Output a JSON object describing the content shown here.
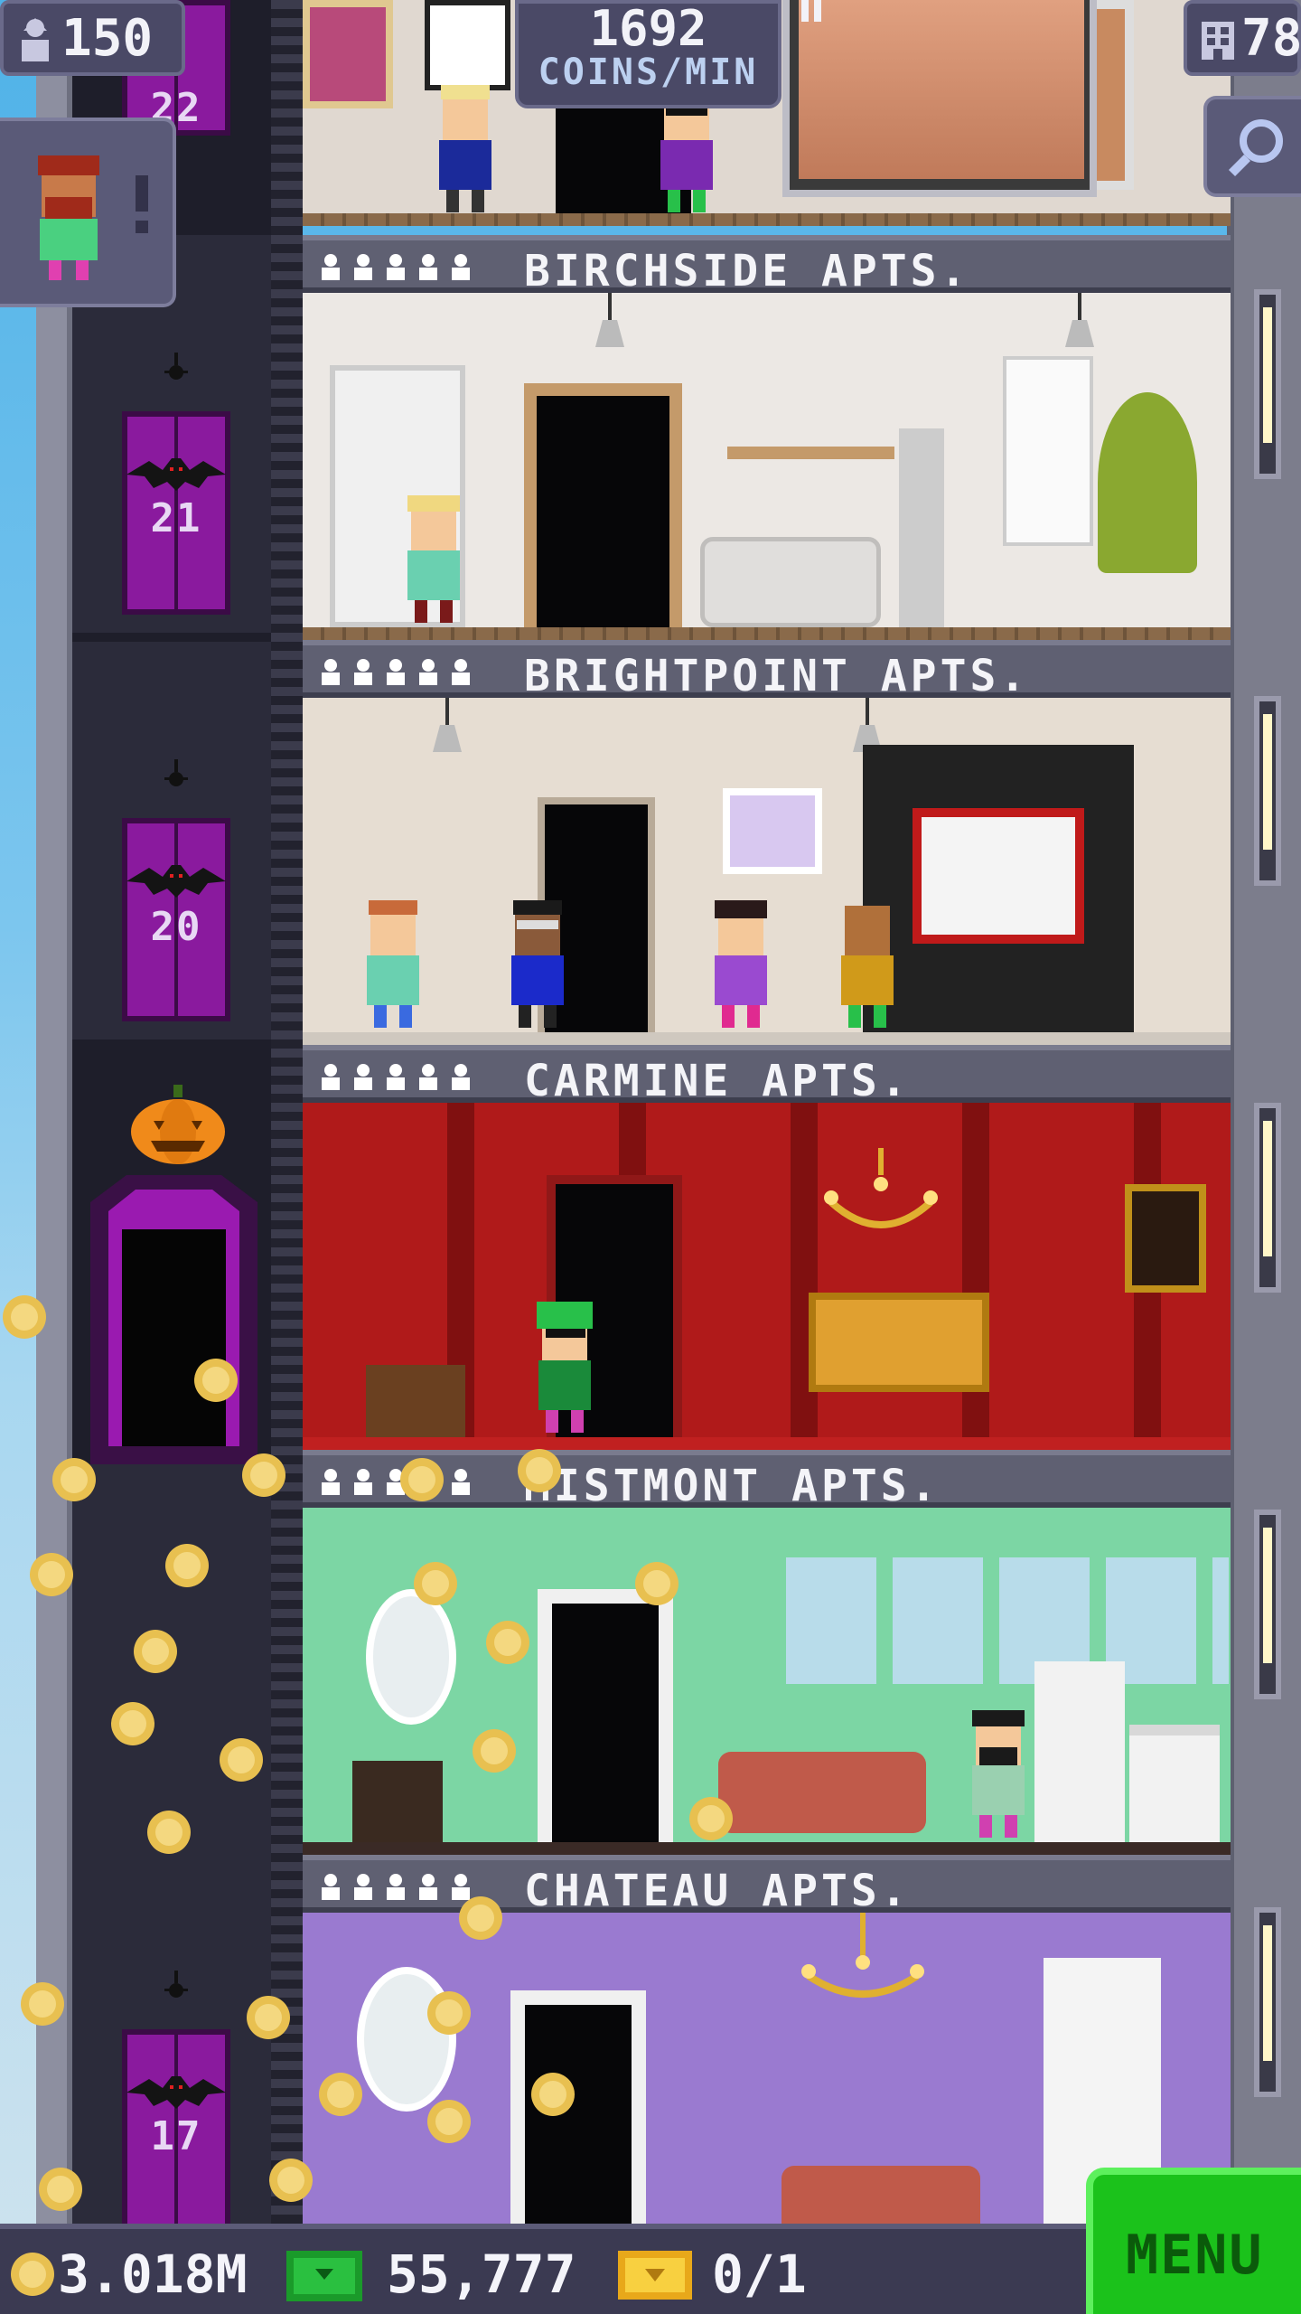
{
  "hud": {
    "bitizens_count": "150",
    "coins_per_min_value": "1692",
    "coins_per_min_label": "COINS/MIN",
    "floor_count": "78"
  },
  "elevator": {
    "floor_numbers": [
      "22",
      "21",
      "20",
      "17"
    ]
  },
  "floors": [
    {
      "name": "BIRCHSIDE APTS."
    },
    {
      "name": "BRIGHTPOINT APTS."
    },
    {
      "name": "CARMINE APTS."
    },
    {
      "name": "MISTMONT APTS."
    },
    {
      "name": "CHATEAU APTS."
    }
  ],
  "bottom_bar": {
    "coins": "3.018M",
    "bux": "55,777",
    "golden_tickets": "0/1",
    "menu_label": "MENU"
  },
  "colors": {
    "elevator_door": "#8a1a9e",
    "menu_button": "#1bc21b",
    "hud_panel": "#4a4966",
    "coin": "#e8c050"
  },
  "icons": [
    "bitizen-icon",
    "floor-grid-icon",
    "pause-icon",
    "search-icon",
    "coin-icon",
    "bux-icon",
    "gold-ticket-icon",
    "bat-icon",
    "pumpkin-icon"
  ]
}
